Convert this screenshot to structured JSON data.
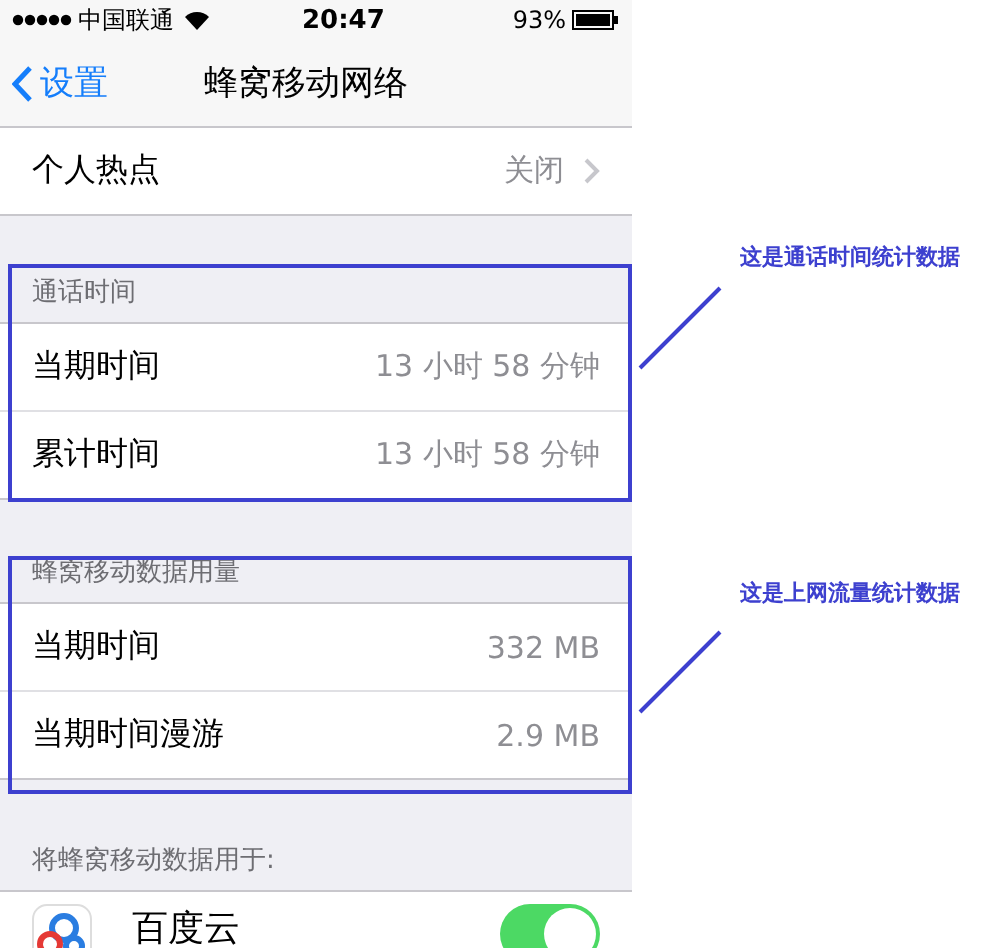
{
  "status_bar": {
    "carrier": "中国联通",
    "time": "20:47",
    "battery": "93%"
  },
  "nav": {
    "back": "设置",
    "title": "蜂窝移动网络"
  },
  "hotspot": {
    "label": "个人热点",
    "value": "关闭"
  },
  "sections": [
    {
      "header": "通话时间",
      "rows": [
        {
          "label": "当期时间",
          "value": "13 小时 58 分钟"
        },
        {
          "label": "累计时间",
          "value": "13 小时 58 分钟"
        }
      ]
    },
    {
      "header": "蜂窝移动数据用量",
      "rows": [
        {
          "label": "当期时间",
          "value": "332 MB"
        },
        {
          "label": "当期时间漫游",
          "value": "2.9 MB"
        }
      ]
    }
  ],
  "apps_header": "将蜂窝移动数据用于:",
  "apps": [
    {
      "name": "百度云",
      "on": true
    }
  ],
  "annotations": [
    "这是通话时间统计数据",
    "这是上网流量统计数据"
  ]
}
